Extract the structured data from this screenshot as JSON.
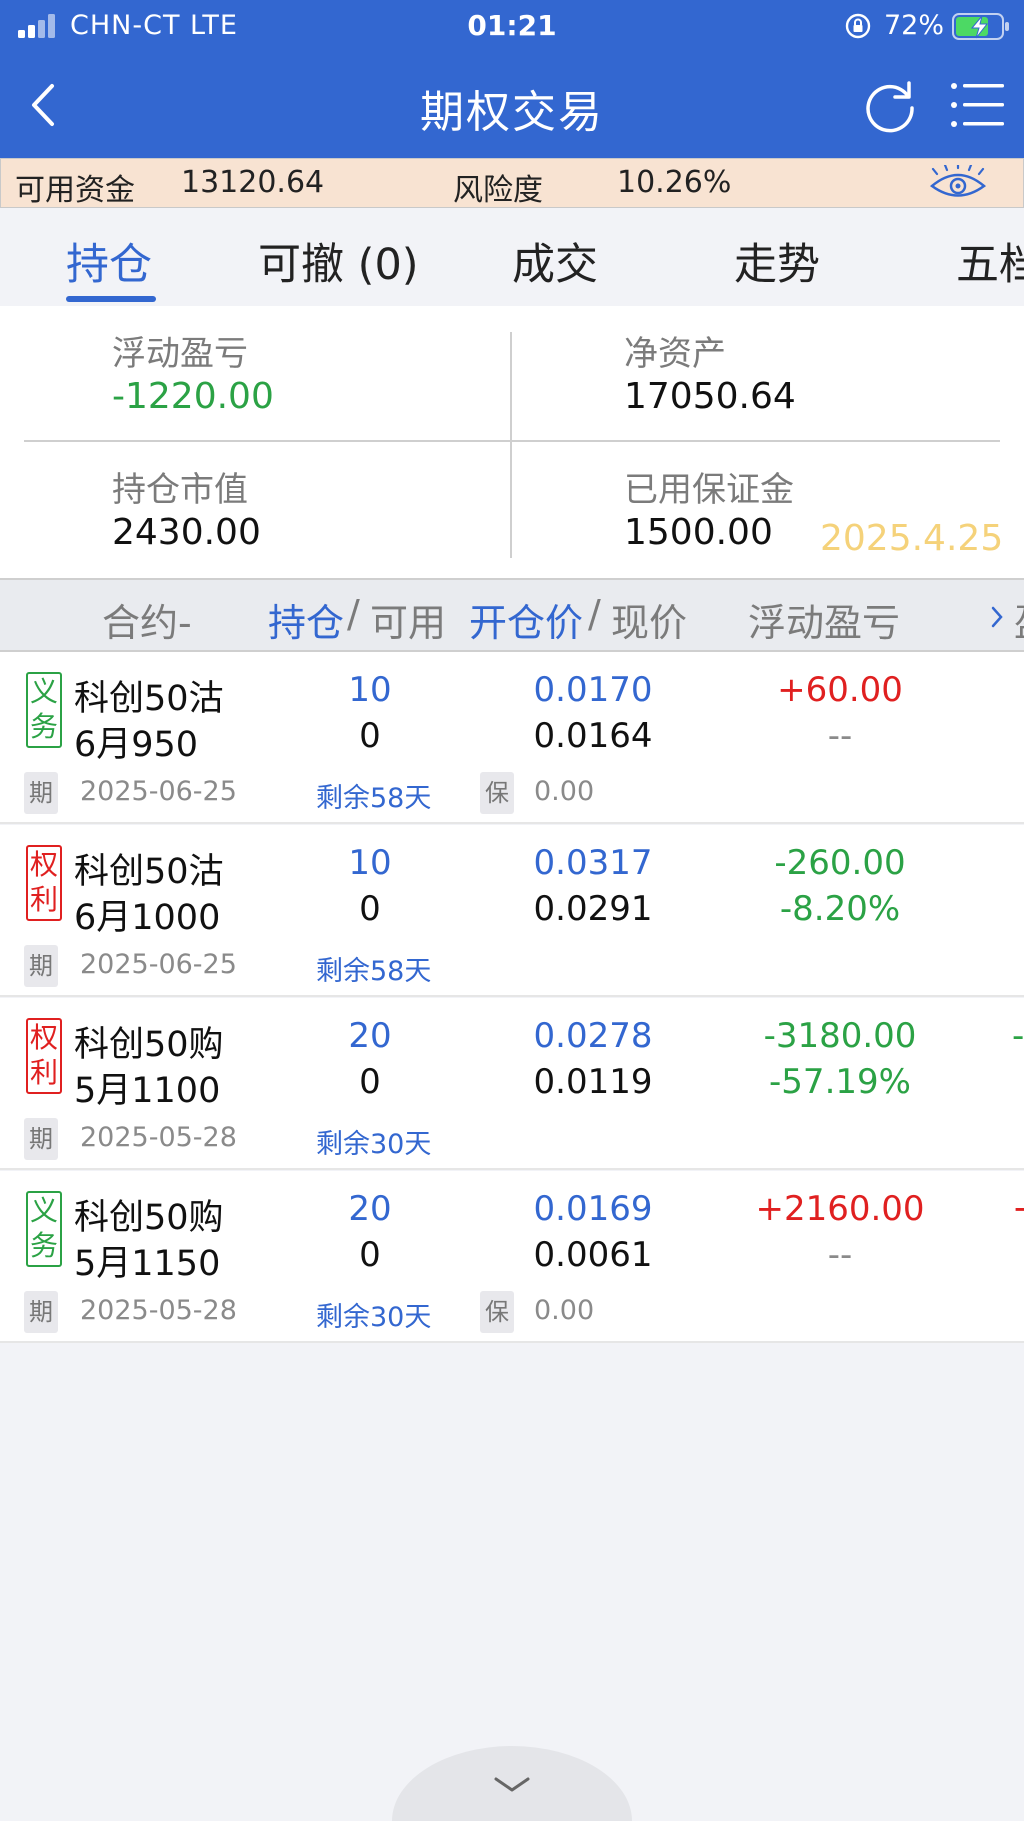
{
  "status_bar": {
    "carrier": "CHN-CT  LTE",
    "time": "01:21",
    "battery": "72%"
  },
  "nav": {
    "title": "期权交易"
  },
  "fund_bar": {
    "available_label": "可用资金",
    "available_value": "13120.64",
    "risk_label": "风险度",
    "risk_value": "10.26%"
  },
  "tabs": [
    {
      "label": "持仓"
    },
    {
      "label": "可撤 (0)"
    },
    {
      "label": "成交"
    },
    {
      "label": "走势"
    },
    {
      "label": "五档"
    }
  ],
  "summary": {
    "floating_pnl_label": "浮动盈亏",
    "floating_pnl_value": "-1220.00",
    "net_assets_label": "净资产",
    "net_assets_value": "17050.64",
    "market_value_label": "持仓市值",
    "market_value_value": "2430.00",
    "margin_used_label": "已用保证金",
    "margin_used_value": "1500.00",
    "date_stamp": "2025.4.25"
  },
  "table_header": {
    "contract": "合约-",
    "position": "持仓",
    "slash1": "/",
    "available": "可用",
    "open_price": "开仓价",
    "slash2": "/",
    "current_price": "现价",
    "floating_pnl": "浮动盈亏",
    "more": "盈"
  },
  "rows": [
    {
      "badge": [
        "义",
        "务"
      ],
      "badge_color": "#2ba245",
      "name": "科创50沽",
      "sub": "6月950",
      "position": "10",
      "available": "0",
      "open_price": "0.0170",
      "current_price": "0.0164",
      "pnl": "+60.00",
      "pnl_pct": "--",
      "chip_expiry": "期",
      "expiry": "2025-06-25",
      "remaining": "剩余58天",
      "chip_margin": "保",
      "margin": "0.00",
      "cut_text": ""
    },
    {
      "badge": [
        "权",
        "利"
      ],
      "badge_color": "#e02020",
      "name": "科创50沽",
      "sub": "6月1000",
      "position": "10",
      "available": "0",
      "open_price": "0.0317",
      "current_price": "0.0291",
      "pnl": "-260.00",
      "pnl_pct": "-8.20%",
      "chip_expiry": "期",
      "expiry": "2025-06-25",
      "remaining": "剩余58天",
      "cut_text": ""
    },
    {
      "badge": [
        "权",
        "利"
      ],
      "badge_color": "#e02020",
      "name": "科创50购",
      "sub": "5月1100",
      "position": "20",
      "available": "0",
      "open_price": "0.0278",
      "current_price": "0.0119",
      "pnl": "-3180.00",
      "pnl_pct": "-57.19%",
      "chip_expiry": "期",
      "expiry": "2025-05-28",
      "remaining": "剩余30天",
      "cut_text": "-"
    },
    {
      "badge": [
        "义",
        "务"
      ],
      "badge_color": "#2ba245",
      "name": "科创50购",
      "sub": "5月1150",
      "position": "20",
      "available": "0",
      "open_price": "0.0169",
      "current_price": "0.0061",
      "pnl": "+2160.00",
      "pnl_pct": "--",
      "chip_expiry": "期",
      "expiry": "2025-05-28",
      "remaining": "剩余30天",
      "chip_margin": "保",
      "margin": "0.00",
      "cut_text": "+"
    }
  ],
  "colors": {
    "brand_blue": "#3367d0",
    "profit_red": "#e02020",
    "loss_green": "#2ba245",
    "fund_bar_bg": "#f8e3d2"
  },
  "icons": [
    "signal-icon",
    "lock-icon",
    "battery-icon",
    "back-icon",
    "refresh-icon",
    "menu-icon",
    "eye-icon",
    "chevron-right-icon",
    "chevron-down-icon"
  ]
}
